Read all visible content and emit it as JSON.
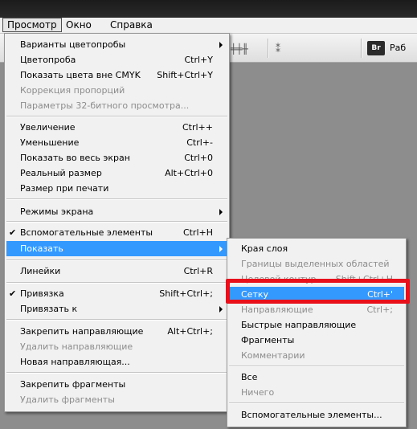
{
  "menubar": {
    "items": [
      {
        "label": "Просмотр"
      },
      {
        "label": "Окно"
      },
      {
        "label": "Справка"
      }
    ]
  },
  "toolbar": {
    "bridge_label": "Br",
    "workspace_label": "Раб"
  },
  "view_menu": {
    "items": [
      {
        "label": "Варианты цветопробы",
        "shortcut": "",
        "submenu": true,
        "disabled": false,
        "checked": false
      },
      {
        "label": "Цветопроба",
        "shortcut": "Ctrl+Y",
        "disabled": false,
        "checked": false
      },
      {
        "label": "Показать цвета вне CMYK",
        "shortcut": "Shift+Ctrl+Y",
        "disabled": false,
        "checked": false
      },
      {
        "label": "Коррекция пропорций",
        "shortcut": "",
        "disabled": true,
        "checked": false
      },
      {
        "label": "Параметры 32-битного просмотра...",
        "shortcut": "",
        "disabled": true,
        "checked": false
      },
      {
        "label": "Увеличение",
        "shortcut": "Ctrl++",
        "disabled": false,
        "checked": false
      },
      {
        "label": "Уменьшение",
        "shortcut": "Ctrl+-",
        "disabled": false,
        "checked": false
      },
      {
        "label": "Показать во весь экран",
        "shortcut": "Ctrl+0",
        "disabled": false,
        "checked": false
      },
      {
        "label": "Реальный размер",
        "shortcut": "Alt+Ctrl+0",
        "disabled": false,
        "checked": false
      },
      {
        "label": "Размер при печати",
        "shortcut": "",
        "disabled": false,
        "checked": false
      },
      {
        "label": "Режимы экрана",
        "shortcut": "",
        "submenu": true,
        "disabled": false,
        "checked": false
      },
      {
        "label": "Вспомогательные элементы",
        "shortcut": "Ctrl+H",
        "disabled": false,
        "checked": true
      },
      {
        "label": "Показать",
        "shortcut": "",
        "submenu": true,
        "disabled": false,
        "checked": false,
        "highlighted": true
      },
      {
        "label": "Линейки",
        "shortcut": "Ctrl+R",
        "disabled": false,
        "checked": false
      },
      {
        "label": "Привязка",
        "shortcut": "Shift+Ctrl+;",
        "disabled": false,
        "checked": true
      },
      {
        "label": "Привязать к",
        "shortcut": "",
        "submenu": true,
        "disabled": false,
        "checked": false
      },
      {
        "label": "Закрепить направляющие",
        "shortcut": "Alt+Ctrl+;",
        "disabled": false,
        "checked": false
      },
      {
        "label": "Удалить направляющие",
        "shortcut": "",
        "disabled": true,
        "checked": false
      },
      {
        "label": "Новая направляющая...",
        "shortcut": "",
        "disabled": false,
        "checked": false
      },
      {
        "label": "Закрепить фрагменты",
        "shortcut": "",
        "disabled": false,
        "checked": false
      },
      {
        "label": "Удалить фрагменты",
        "shortcut": "",
        "disabled": true,
        "checked": false
      }
    ]
  },
  "show_submenu": {
    "items": [
      {
        "label": "Края слоя",
        "shortcut": "",
        "disabled": false
      },
      {
        "label": "Границы выделенных областей",
        "shortcut": "",
        "disabled": true
      },
      {
        "label": "Целевой контур",
        "shortcut": "Shift+Ctrl+H",
        "disabled": true
      },
      {
        "label": "Сетку",
        "shortcut": "Ctrl+'",
        "disabled": false,
        "highlighted": true
      },
      {
        "label": "Направляющие",
        "shortcut": "Ctrl+;",
        "disabled": true
      },
      {
        "label": "Быстрые направляющие",
        "shortcut": "",
        "disabled": false
      },
      {
        "label": "Фрагменты",
        "shortcut": "",
        "disabled": false
      },
      {
        "label": "Комментарии",
        "shortcut": "",
        "disabled": true
      },
      {
        "label": "Все",
        "shortcut": "",
        "disabled": false
      },
      {
        "label": "Ничего",
        "shortcut": "",
        "disabled": true
      },
      {
        "label": "Вспомогательные элементы...",
        "shortcut": "",
        "disabled": false
      }
    ]
  },
  "colors": {
    "highlight": "#3399ff",
    "callout": "#e8101a"
  }
}
